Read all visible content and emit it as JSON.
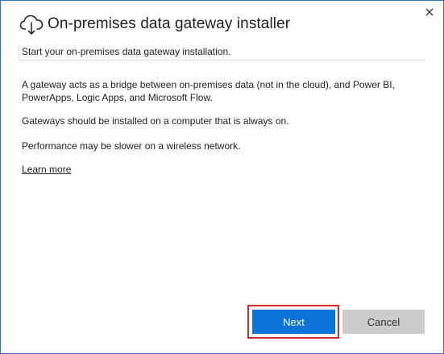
{
  "window": {
    "title": "On-premises data gateway installer",
    "close_icon": "close-icon",
    "app_icon": "cloud-download-icon"
  },
  "subtitle": "Start your on-premises data gateway installation.",
  "content": {
    "paragraph_1": "A gateway acts as a bridge between on-premises data (not in the cloud), and Power BI, PowerApps, Logic Apps, and Microsoft Flow.",
    "paragraph_2": "Gateways should be installed on a computer that is always on.",
    "paragraph_3": "Performance may be slower on a wireless network.",
    "learn_more": "Learn more"
  },
  "buttons": {
    "next": "Next",
    "cancel": "Cancel"
  },
  "colors": {
    "primary": "#0a73d9",
    "secondary": "#cccccc",
    "highlight": "#d92b2b",
    "window_border": "#2b6fc7"
  }
}
